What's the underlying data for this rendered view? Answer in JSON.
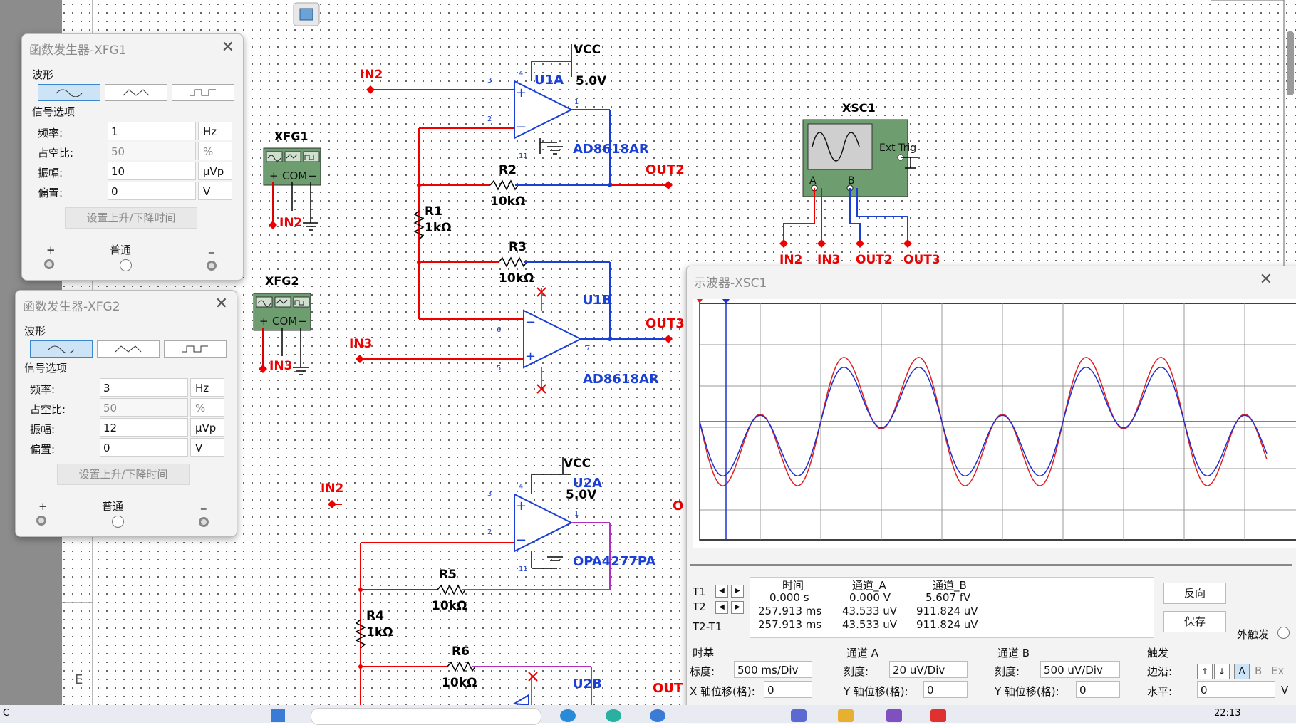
{
  "schematic": {
    "xfg1_label": "XFG1",
    "xfg2_label": "XFG2",
    "xsc1_label": "XSC1",
    "com": "COM",
    "ext_trig": "Ext Trig",
    "ch_a": "A",
    "ch_b": "B",
    "vcc": "VCC",
    "v5": "5.0V",
    "u1a": "U1A",
    "u1b": "U1B",
    "u2a": "U2A",
    "u2b": "U2B",
    "ad8618": "AD8618AR",
    "opa4277": "OPA4277PA",
    "r1": "R1",
    "r2": "R2",
    "r3": "R3",
    "r4": "R4",
    "r5": "R5",
    "r6": "R6",
    "k1": "1kΩ",
    "k10": "10kΩ",
    "in2": "IN2",
    "in3": "IN3",
    "out2": "OUT2",
    "out3": "OUT3",
    "out_partial": "OUT",
    "o_partial": "O",
    "e_mark": "E",
    "pin1": "1",
    "pin2": "2",
    "pin3": "3",
    "pin4": "4",
    "pin5": "5",
    "pin6": "6",
    "pin7": "7",
    "pin11": "11"
  },
  "xfg1": {
    "title": "函数发生器-XFG1",
    "waveform_label": "波形",
    "signal_options": "信号选项",
    "freq_label": "频率:",
    "freq_value": "1",
    "freq_unit": "Hz",
    "duty_label": "占空比:",
    "duty_value": "50",
    "duty_unit": "%",
    "amp_label": "振幅:",
    "amp_value": "10",
    "amp_unit": "µVp",
    "offset_label": "偏置:",
    "offset_value": "0",
    "offset_unit": "V",
    "rise_button": "设置上升/下降时间",
    "plus": "+",
    "common": "普通",
    "minus": "_"
  },
  "xfg2": {
    "title": "函数发生器-XFG2",
    "waveform_label": "波形",
    "signal_options": "信号选项",
    "freq_label": "频率:",
    "freq_value": "3",
    "freq_unit": "Hz",
    "duty_label": "占空比:",
    "duty_value": "50",
    "duty_unit": "%",
    "amp_label": "振幅:",
    "amp_value": "12",
    "amp_unit": "µVp",
    "offset_label": "偏置:",
    "offset_value": "0",
    "offset_unit": "V",
    "rise_button": "设置上升/下降时间",
    "plus": "+",
    "common": "普通",
    "minus": "_"
  },
  "scope": {
    "title": "示波器-XSC1",
    "t1": "T1",
    "t2": "T2",
    "t2t1": "T2-T1",
    "col_time": "时间",
    "col_a": "通道_A",
    "col_b": "通道_B",
    "row1": [
      "0.000 s",
      "0.000 V",
      "5.607 fV"
    ],
    "row2": [
      "257.913 ms",
      "43.533 uV",
      "911.824 uV"
    ],
    "row3": [
      "257.913 ms",
      "43.533 uV",
      "911.824 uV"
    ],
    "reverse_button": "反向",
    "save_button": "保存",
    "ext_trigger": "外触发",
    "timebase": "时基",
    "scale_label": "标度:",
    "scale_value": "500 ms/Div",
    "x_offset_label": "X 轴位移(格):",
    "x_offset_value": "0",
    "ch_a_title": "通道 A",
    "ch_a_scale_label": "刻度:",
    "ch_a_scale": "20 uV/Div",
    "ch_a_y_label": "Y 轴位移(格):",
    "ch_a_y": "0",
    "ch_b_title": "通道 B",
    "ch_b_scale_label": "刻度:",
    "ch_b_scale": "500 uV/Div",
    "ch_b_y_label": "Y 轴位移(格):",
    "ch_b_y": "0",
    "trigger_title": "触发",
    "edge_label": "边沿:",
    "level_label": "水平:",
    "level_value": "0",
    "level_unit": "V",
    "trig_a": "A",
    "trig_b": "B",
    "trig_ext_partial": "Ex",
    "colors": {
      "trace_a": "#e02020",
      "trace_b": "#2030d0"
    }
  },
  "taskbar": {
    "clock": "22:13",
    "left_char": "C"
  }
}
